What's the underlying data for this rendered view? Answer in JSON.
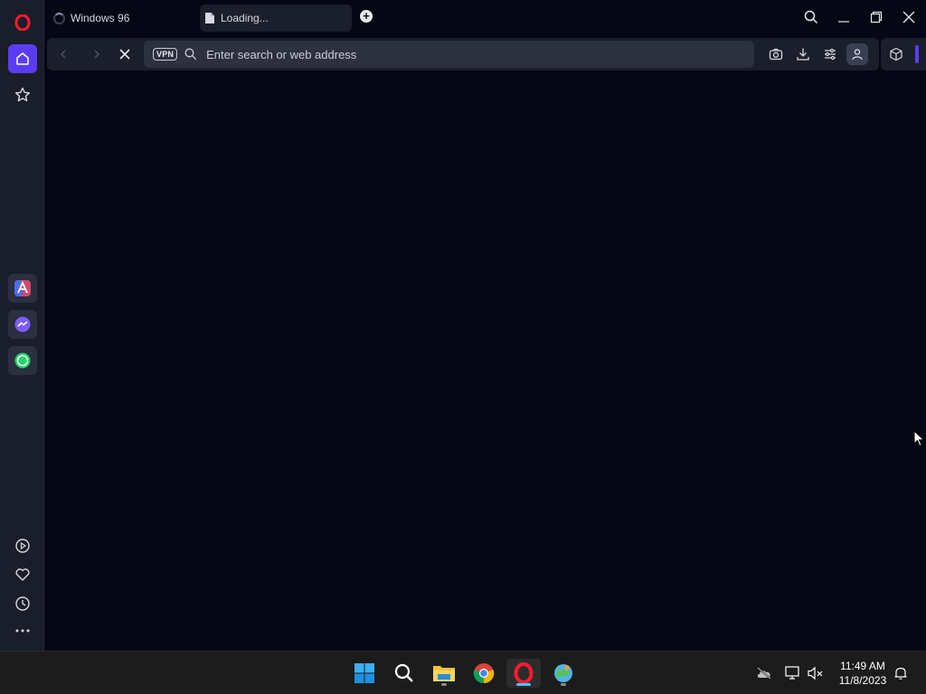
{
  "browser": {
    "tabs": [
      {
        "title": "Windows 96",
        "active": false,
        "loading": true
      },
      {
        "title": "Loading...",
        "active": true,
        "loading": true
      }
    ],
    "address_bar": {
      "vpn_label": "VPN",
      "placeholder": "Enter search or web address",
      "value": ""
    },
    "accent_color": "#5b3cf5",
    "sidebar": {
      "top_items": [
        "opera-logo",
        "home-icon",
        "bookmarks-star-icon"
      ],
      "apps": [
        "aria-icon",
        "messenger-icon",
        "whatsapp-icon"
      ],
      "bottom_items": [
        "player-icon",
        "heart-icon",
        "history-clock-icon",
        "more-dots-icon"
      ]
    }
  },
  "taskbar": {
    "apps": [
      "windows-start-icon",
      "search-icon",
      "file-explorer-icon",
      "chrome-icon",
      "opera-icon",
      "globe-app-icon"
    ],
    "active_app": "opera-icon",
    "clock": {
      "time": "11:49 AM",
      "date": "11/8/2023"
    }
  }
}
